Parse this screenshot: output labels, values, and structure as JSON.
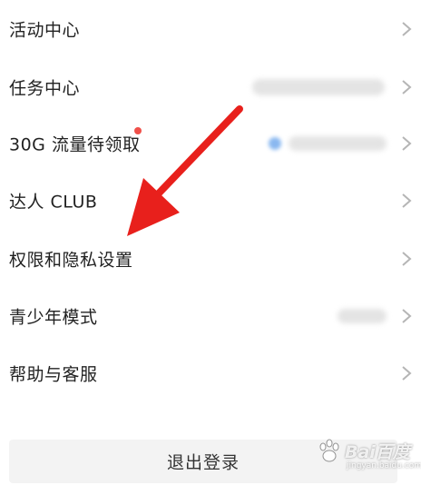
{
  "menu": {
    "items": [
      {
        "label": "活动中心"
      },
      {
        "label": "任务中心"
      },
      {
        "label": "30G 流量待领取"
      },
      {
        "label": "达人 CLUB"
      },
      {
        "label": "权限和隐私设置"
      },
      {
        "label": "青少年模式"
      },
      {
        "label": "帮助与客服"
      }
    ]
  },
  "logout": {
    "label": "退出登录"
  },
  "colors": {
    "annotation_arrow": "#e8201c",
    "badge": "#f0504a",
    "chevron": "#b5b5b5"
  },
  "watermark": {
    "text": "Bai百度",
    "sub": "jingyan.baidu.com"
  }
}
